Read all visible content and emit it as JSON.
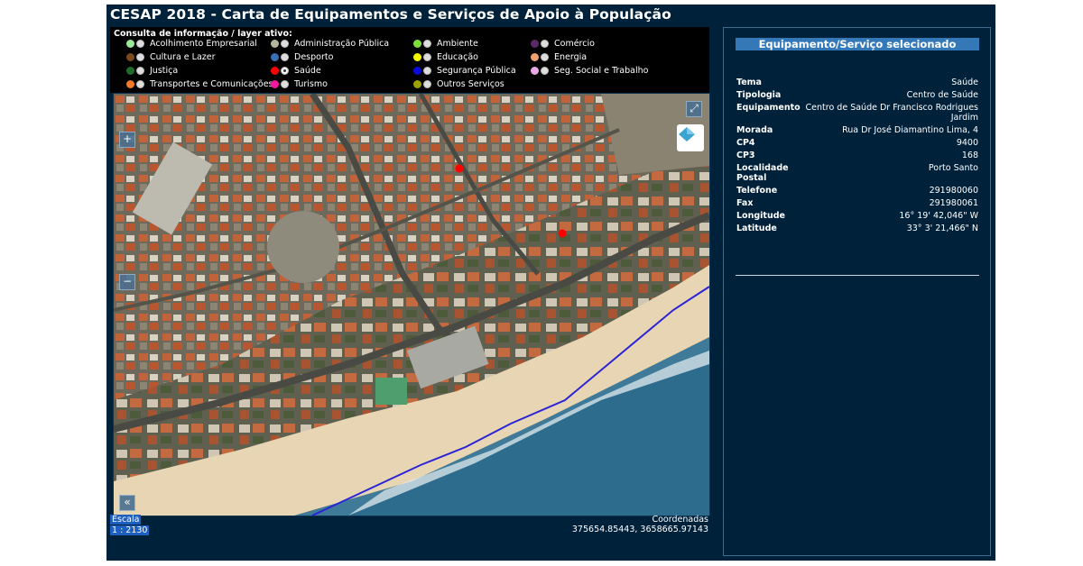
{
  "title": "CESAP 2018 - Carta de Equipamentos e Serviços de Apoio à População",
  "legend": {
    "title": "Consulta de informação / layer ativo:",
    "items": [
      {
        "label": "Acolhimento Empresarial",
        "color": "#9be89b"
      },
      {
        "label": "Administração Pública",
        "color": "#b5b39a"
      },
      {
        "label": "Ambiente",
        "color": "#7de03a"
      },
      {
        "label": "Comércio",
        "color": "#5a2a66"
      },
      {
        "label": "Cultura e Lazer",
        "color": "#7a4a1e"
      },
      {
        "label": "Desporto",
        "color": "#3b6fb5"
      },
      {
        "label": "Educação",
        "color": "#f5f500"
      },
      {
        "label": "Energia",
        "color": "#f0a070"
      },
      {
        "label": "Justiça",
        "color": "#1f6b2a"
      },
      {
        "label": "Saúde",
        "color": "#ff0000"
      },
      {
        "label": "Segurança Pública",
        "color": "#0a0adc"
      },
      {
        "label": "Seg. Social e Trabalho",
        "color": "#e9a9e9"
      },
      {
        "label": "Transportes e Comunicações",
        "color": "#f07a2a"
      },
      {
        "label": "Turismo",
        "color": "#f01aa0"
      },
      {
        "label": "Outros Serviços",
        "color": "#9ea000"
      }
    ],
    "active": "Saúde"
  },
  "map": {
    "zoom_in": "+",
    "zoom_out": "−",
    "collapse": "«",
    "fullscreen": "⤢",
    "scale_label": "Escala",
    "scale_value": "1 : 2130",
    "coords_label": "Coordenadas",
    "coords_value": "375654.85443, 3658665.97143"
  },
  "panel": {
    "header": "Equipamento/Serviço selecionado",
    "rows": [
      {
        "k": "Tema",
        "v": "Saúde"
      },
      {
        "k": "Tipologia",
        "v": "Centro de Saúde"
      },
      {
        "k": "Equipamento",
        "v": "Centro de Saúde Dr Francisco Rodrigues Jardim"
      },
      {
        "k": "Morada",
        "v": "Rua Dr José Diamantino Lima, 4"
      },
      {
        "k": "CP4",
        "v": "9400"
      },
      {
        "k": "CP3",
        "v": "168"
      },
      {
        "k": "Localidade Postal",
        "v": "Porto Santo"
      },
      {
        "k": "Telefone",
        "v": "291980060"
      },
      {
        "k": "Fax",
        "v": "291980061"
      },
      {
        "k": "Longitude",
        "v": "16° 19' 42,046\" W"
      },
      {
        "k": "Latitude",
        "v": "33° 3' 21,466\" N"
      }
    ]
  }
}
